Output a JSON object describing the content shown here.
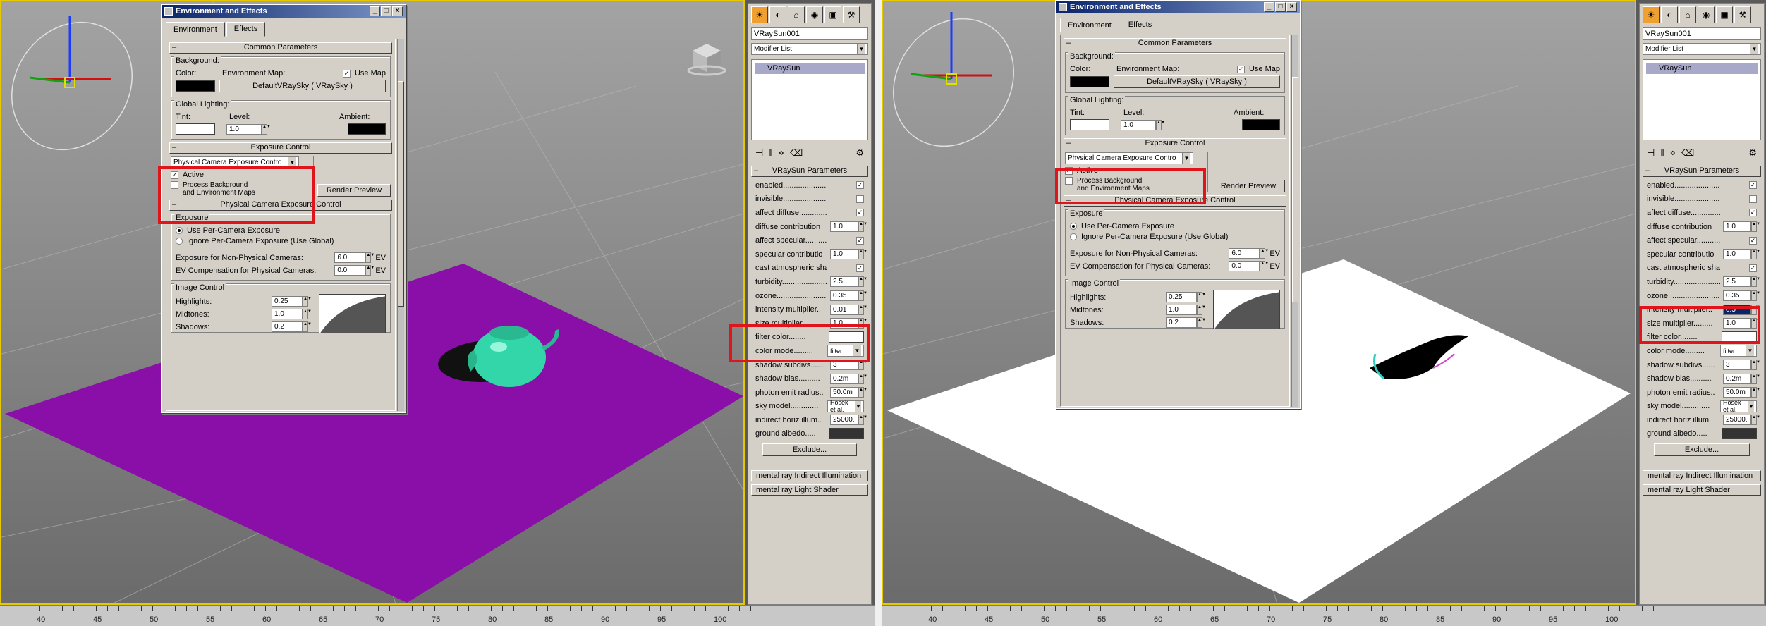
{
  "left": {
    "dialog": {
      "title": "Environment and Effects",
      "tabs": [
        "Environment",
        "Effects"
      ],
      "common_parameters": "Common Parameters",
      "background_label": "Background:",
      "color_label": "Color:",
      "env_map_label": "Environment Map:",
      "use_map_label": "Use Map",
      "env_map_button": "DefaultVRaySky  ( VRaySky )",
      "global_lighting_label": "Global Lighting:",
      "tint_label": "Tint:",
      "level_label": "Level:",
      "level_value": "1.0",
      "ambient_label": "Ambient:",
      "exposure_control": "Exposure Control",
      "exposure_dropdown": "Physical Camera Exposure Contro",
      "active_label": "Active",
      "process_bg_label": "Process Background\nand Environment Maps",
      "render_preview": "Render Preview",
      "pce_header": "Physical Camera Exposure Control",
      "exposure_label": "Exposure",
      "use_per_camera": "Use Per-Camera Exposure",
      "ignore_per_camera": "Ignore Per-Camera Exposure (Use Global)",
      "exp_nonphys_label": "Exposure for Non-Physical Cameras:",
      "exp_nonphys_value": "6.0",
      "ev_comp_label": "EV Compensation for Physical Cameras:",
      "ev_comp_value": "0.0",
      "ev_unit": "EV",
      "image_control_label": "Image Control",
      "highlights_label": "Highlights:",
      "highlights_value": "0.25",
      "midtones_label": "Midtones:",
      "midtones_value": "1.0",
      "shadows_label": "Shadows:",
      "shadows_value": "0.2"
    },
    "cmd": {
      "object_name": "VRaySun001",
      "modifier_list": "Modifier List",
      "stack_item": "VRaySun",
      "rollout_title": "VRaySun Parameters",
      "params": [
        {
          "label": "enabled...........................",
          "ctl": "check",
          "val": "✓"
        },
        {
          "label": "invisible.........................",
          "ctl": "check",
          "val": ""
        },
        {
          "label": "affect diffuse..................",
          "ctl": "check",
          "val": "✓"
        },
        {
          "label": "diffuse contribution",
          "ctl": "spin",
          "val": "1.0"
        },
        {
          "label": "affect specular.................",
          "ctl": "check",
          "val": "✓"
        },
        {
          "label": "specular contributio",
          "ctl": "spin",
          "val": "1.0"
        },
        {
          "label": "cast atmospheric shadows..",
          "ctl": "check",
          "val": "✓"
        },
        {
          "label": "turbidity........................",
          "ctl": "spin",
          "val": "2.5"
        },
        {
          "label": "ozone.............................",
          "ctl": "spin",
          "val": "0.35"
        },
        {
          "label": "intensity multiplier..",
          "ctl": "spin",
          "val": "0.01"
        },
        {
          "label": "size multiplier.........",
          "ctl": "spin",
          "val": "1.0"
        },
        {
          "label": "filter color........",
          "ctl": "swatch",
          "val": ""
        },
        {
          "label": "color mode.........",
          "ctl": "dd",
          "val": "filter"
        },
        {
          "label": "shadow subdivs......",
          "ctl": "spin",
          "val": "3"
        },
        {
          "label": "shadow bias..........",
          "ctl": "spin",
          "val": "0.2m"
        },
        {
          "label": "photon emit radius..",
          "ctl": "spin",
          "val": "50.0m"
        },
        {
          "label": "sky model.............",
          "ctl": "dd",
          "val": "Hosek et al."
        },
        {
          "label": "indirect horiz illum..",
          "ctl": "spin",
          "val": "25000."
        },
        {
          "label": "ground albedo.....",
          "ctl": "dark",
          "val": ""
        }
      ],
      "exclude": "Exclude...",
      "bottom1": "mental ray Indirect Illumination",
      "bottom2": "mental ray Light Shader"
    },
    "ruler": [
      "40",
      "45",
      "50",
      "55",
      "60",
      "65",
      "70",
      "75",
      "80",
      "85",
      "90",
      "95",
      "100"
    ]
  },
  "right": {
    "dialog_title": "Environment and Effects",
    "params_intensity": "0.5"
  }
}
